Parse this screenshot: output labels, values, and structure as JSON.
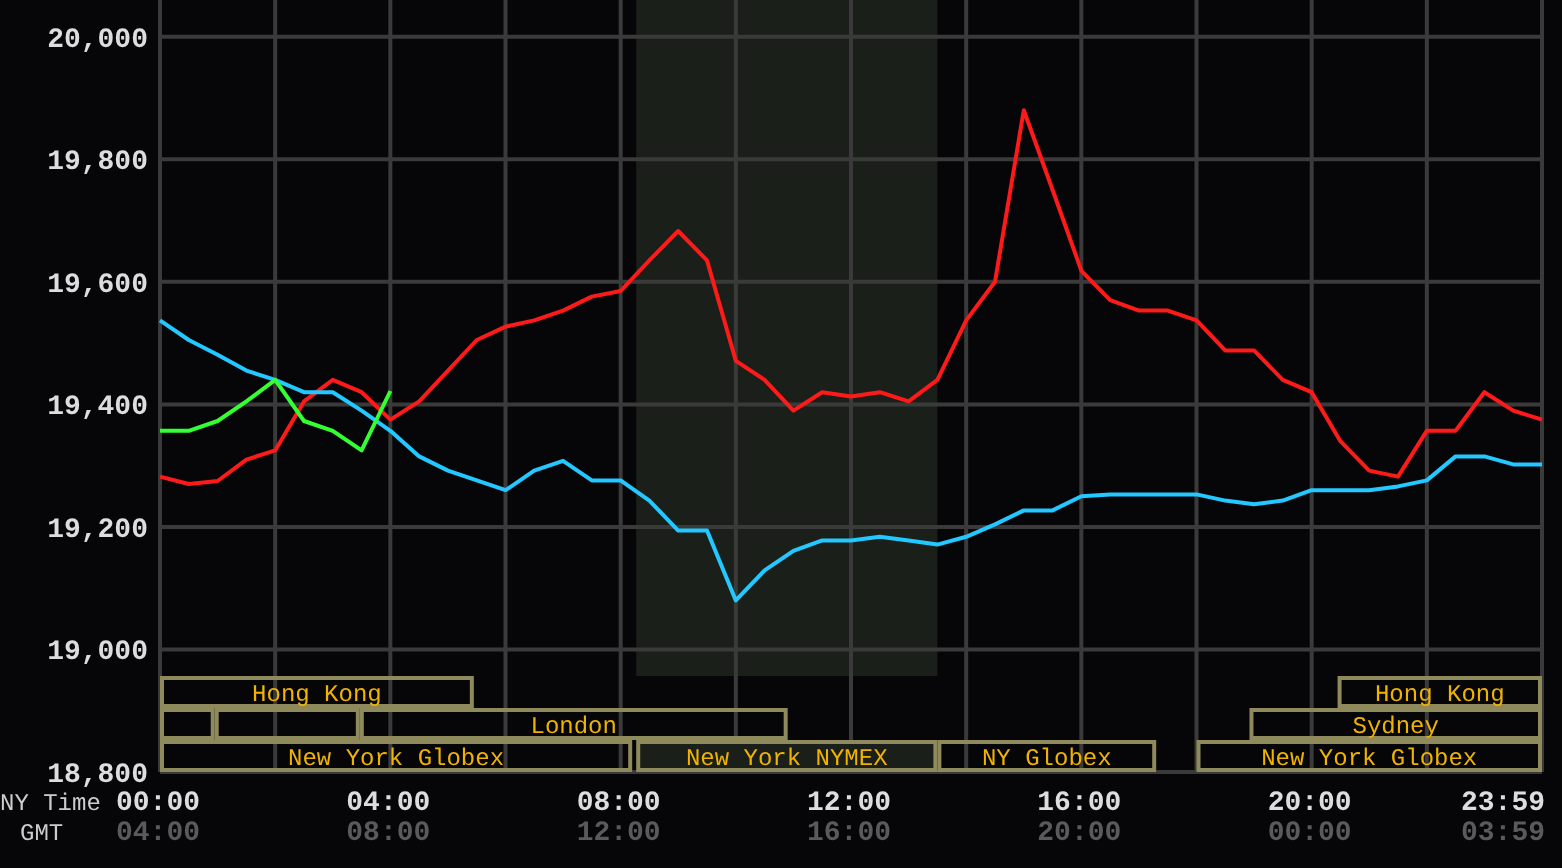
{
  "chart": {
    "chart_data": {
      "type": "line",
      "x": [
        0,
        0.5,
        1,
        1.5,
        2,
        2.5,
        3,
        3.5,
        4,
        4.5,
        5,
        5.5,
        6,
        6.5,
        7,
        7.5,
        8,
        8.5,
        9,
        9.5,
        10,
        10.5,
        11,
        11.5,
        12,
        12.5,
        13,
        13.5,
        14,
        14.5,
        15,
        15.5,
        16,
        16.5,
        17,
        17.5,
        18,
        18.5,
        19,
        19.5,
        20,
        20.5,
        21,
        21.5,
        22,
        22.5,
        23,
        23.5,
        24
      ],
      "series": [
        {
          "color": "#ff1a1a",
          "values": [
            19282,
            19270,
            19275,
            19310,
            19325,
            19405,
            19440,
            19420,
            19375,
            19405,
            19455,
            19505,
            19527,
            19537,
            19553,
            19576,
            19585,
            19635,
            19683,
            19635,
            19471,
            19440,
            19390,
            19420,
            19413,
            19420,
            19405,
            19440,
            19537,
            19600,
            19880,
            19750,
            19618,
            19570,
            19553,
            19553,
            19537,
            19488,
            19488,
            19440,
            19420,
            19340,
            19292,
            19282,
            19357,
            19357,
            19420,
            19390,
            19375
          ]
        },
        {
          "color": "#22c8ff",
          "values": [
            19537,
            19505,
            19481,
            19455,
            19440,
            19420,
            19420,
            19390,
            19357,
            19315,
            19292,
            19276,
            19260,
            19292,
            19308,
            19276,
            19276,
            19243,
            19194,
            19194,
            19080,
            19129,
            19161,
            19178,
            19178,
            19184,
            19178,
            19171,
            19184,
            19204,
            19227,
            19227,
            19250,
            19253,
            19253,
            19253,
            19253,
            19243,
            19237,
            19243,
            19260,
            19260,
            19260,
            19266,
            19276,
            19315,
            19315,
            19302,
            19302
          ]
        },
        {
          "color": "#33ff33",
          "values": [
            19357,
            19357,
            19373,
            19405,
            19440,
            19373,
            19357,
            19325,
            19422,
            null,
            null,
            null,
            null,
            null,
            null,
            null,
            null,
            null,
            null,
            null,
            null,
            null,
            null,
            null,
            null,
            null,
            null,
            null,
            null,
            null,
            null,
            null,
            null,
            null,
            null,
            null,
            null,
            null,
            null,
            null,
            null,
            null,
            null,
            null,
            null,
            null,
            null,
            null,
            null
          ]
        }
      ],
      "xlim": [
        0,
        24
      ],
      "ylim": [
        18800,
        20060
      ],
      "xticks": [
        {
          "value": 0,
          "label": "00:00"
        },
        {
          "value": 4,
          "label": "04:00"
        },
        {
          "value": 8,
          "label": "08:00"
        },
        {
          "value": 12,
          "label": "12:00"
        },
        {
          "value": 16,
          "label": "16:00"
        },
        {
          "value": 20,
          "label": "20:00"
        },
        {
          "value": 23.983,
          "label": "23:59"
        }
      ],
      "yticks": [
        {
          "value": 18800,
          "label": "18,800"
        },
        {
          "value": 19000,
          "label": "19,000"
        },
        {
          "value": 19200,
          "label": "19,200"
        },
        {
          "value": 19400,
          "label": "19,400"
        },
        {
          "value": 19600,
          "label": "19,600"
        },
        {
          "value": 19800,
          "label": "19,800"
        },
        {
          "value": 20000,
          "label": "20,000"
        }
      ],
      "grid": true
    },
    "xaxis_label": "NY Time",
    "gmt_row": {
      "label": "GMT",
      "ticks": [
        "04:00",
        "08:00",
        "12:00",
        "16:00",
        "20:00",
        "00:00",
        "03:59"
      ]
    },
    "session_rows": [
      [
        {
          "label": "Hong Kong",
          "shaded": false
        },
        {
          "label": "Hong Kong",
          "shaded": false
        }
      ],
      [
        {
          "shaded": false
        },
        {
          "shaded": false
        },
        {
          "label": "London",
          "shaded": false
        },
        {
          "label": "Sydney",
          "shaded": false
        }
      ],
      [
        {
          "label": "New York Globex",
          "shaded": false
        },
        {
          "label": "New York NYMEX",
          "shaded": true
        },
        {
          "label": "NY Globex",
          "shaded": false
        },
        {
          "label": "New York Globex",
          "shaded": false
        }
      ]
    ]
  }
}
